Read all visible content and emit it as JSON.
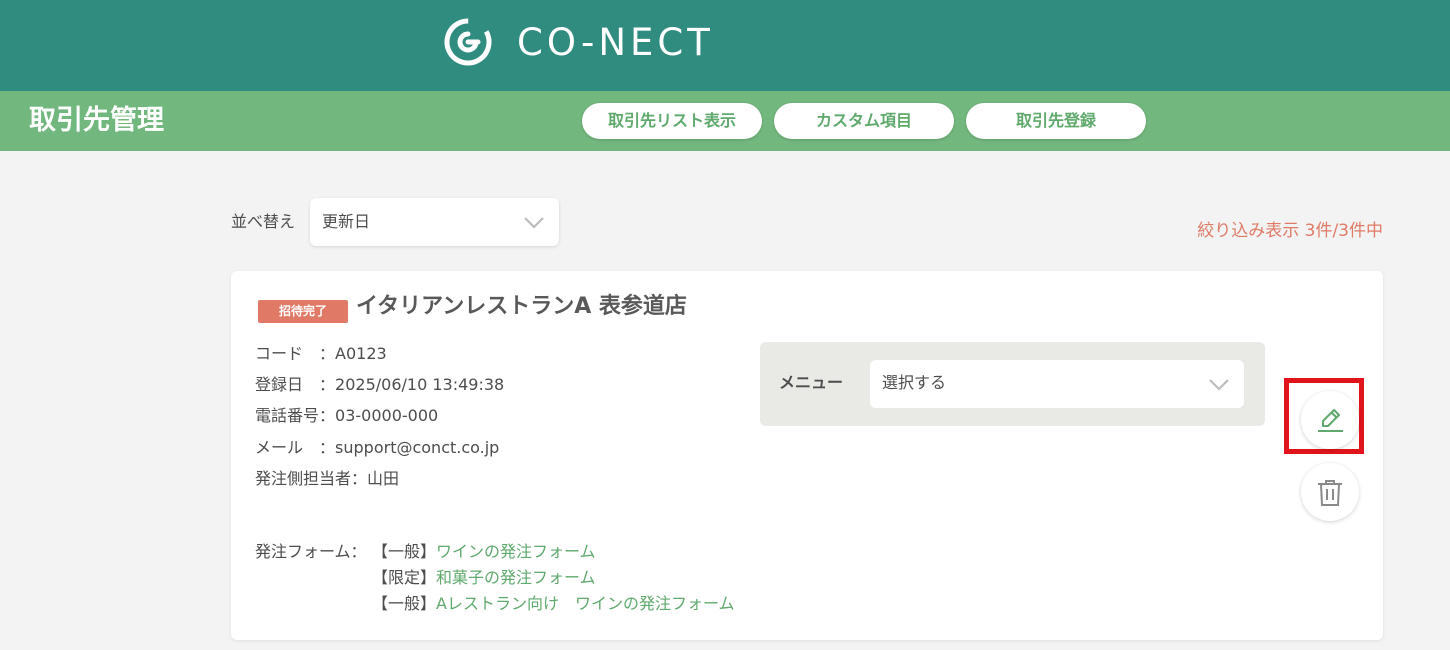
{
  "header": {
    "logo_text": "CO-NECT",
    "brand_color": "#318c80"
  },
  "subheader": {
    "title": "取引先管理",
    "buttons": [
      {
        "label": "取引先リスト表示"
      },
      {
        "label": "カスタム項目"
      },
      {
        "label": "取引先登録"
      }
    ],
    "color": "#72b77e"
  },
  "sort": {
    "label": "並べ替え",
    "selected": "更新日"
  },
  "filter_status": "絞り込み表示  3件/3件中",
  "card": {
    "badge": "招待完了",
    "store_name": "イタリアンレストランA 表参道店",
    "info": [
      {
        "label": "コード",
        "sep": "　：",
        "value": "A0123"
      },
      {
        "label": "登録日",
        "sep": "　：",
        "value": "2025/06/10 13:49:38"
      },
      {
        "label": "電話番号",
        "sep": "：",
        "value": "03-0000-000"
      },
      {
        "label": "メール",
        "sep": "　：",
        "value": "support@conct.co.jp"
      },
      {
        "label": "発注側担当者",
        "sep": "：",
        "value": "山田"
      }
    ],
    "menu": {
      "label": "メニュー",
      "selected": "選択する"
    },
    "forms_label": "発注フォーム：",
    "forms": [
      {
        "tag": "【一般】",
        "name": "ワインの発注フォーム"
      },
      {
        "tag": "【限定】",
        "name": "和菓子の発注フォーム"
      },
      {
        "tag": "【一般】",
        "name": "Aレストラン向け　ワインの発注フォーム"
      }
    ]
  },
  "colors": {
    "accent": "#5fa96c",
    "badge": "#e07a66",
    "highlight": "#e0151b"
  }
}
